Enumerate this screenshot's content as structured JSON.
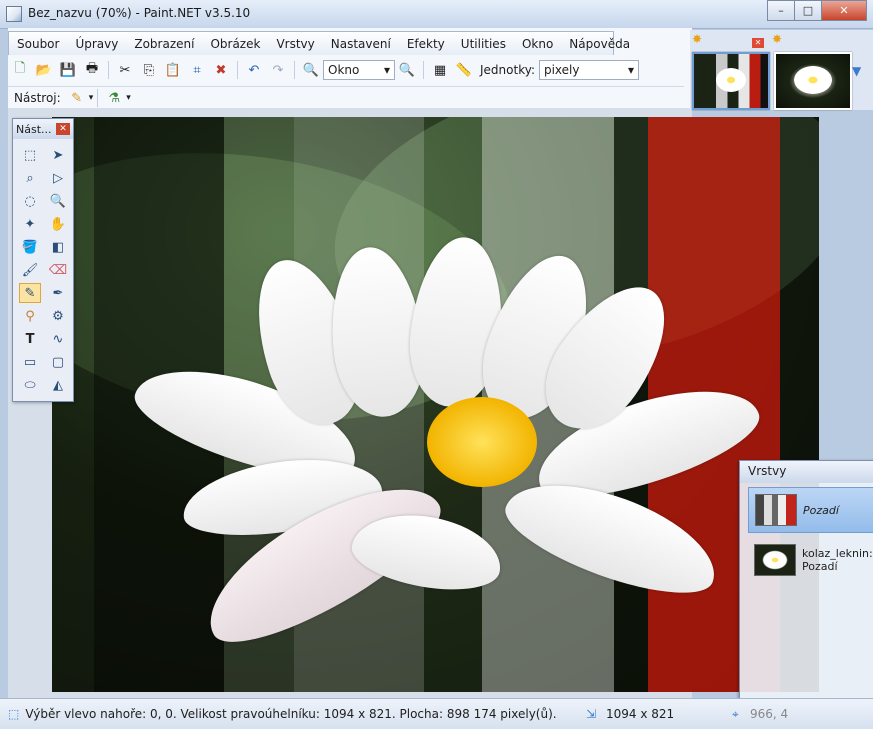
{
  "window": {
    "title": "Bez_nazvu (70%) - Paint.NET v3.5.10"
  },
  "menu": [
    "Soubor",
    "Úpravy",
    "Zobrazení",
    "Obrázek",
    "Vrstvy",
    "Nastavení",
    "Efekty",
    "Utilities",
    "Okno",
    "Nápověda"
  ],
  "toolbar": {
    "zoom_value": "Okno",
    "units_label": "Jednotky:",
    "units_value": "pixely"
  },
  "toolbar2": {
    "tool_label": "Nástroj:"
  },
  "tools_window": {
    "title": "Nást..."
  },
  "layers_window": {
    "title": "Vrstvy",
    "layers": [
      {
        "name": "Pozadí"
      },
      {
        "name": "kolaz_leknin:\nPozadí"
      }
    ]
  },
  "status": {
    "text": "Výběr vlevo nahoře: 0, 0. Velikost pravoúhelníku: 1094 x 821. Plocha: 898 174 pixely(ů).",
    "size": "1094 x 821",
    "coords": "966, 4"
  }
}
